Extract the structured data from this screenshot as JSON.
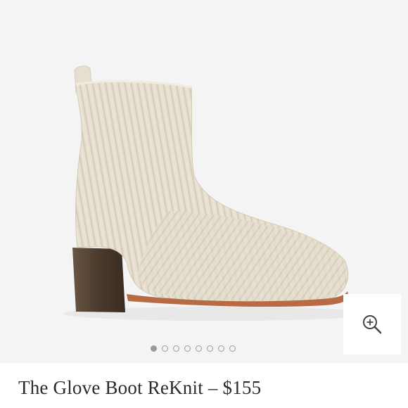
{
  "product": {
    "title": "The Glove Boot ReKnit – $155",
    "image_alt": "The Glove Boot ReKnit",
    "colors": {
      "knit": "#e6dfcf",
      "heel": "#4a3a2c",
      "sole": "#b86a45",
      "background": "#f4f4f4"
    }
  },
  "gallery": {
    "dots": [
      {
        "state": "active"
      },
      {
        "state": "inactive"
      },
      {
        "state": "inactive"
      },
      {
        "state": "inactive"
      },
      {
        "state": "inactive"
      },
      {
        "state": "inactive"
      },
      {
        "state": "inactive"
      },
      {
        "state": "inactive"
      }
    ],
    "zoom_icon": "zoom-in-icon"
  }
}
